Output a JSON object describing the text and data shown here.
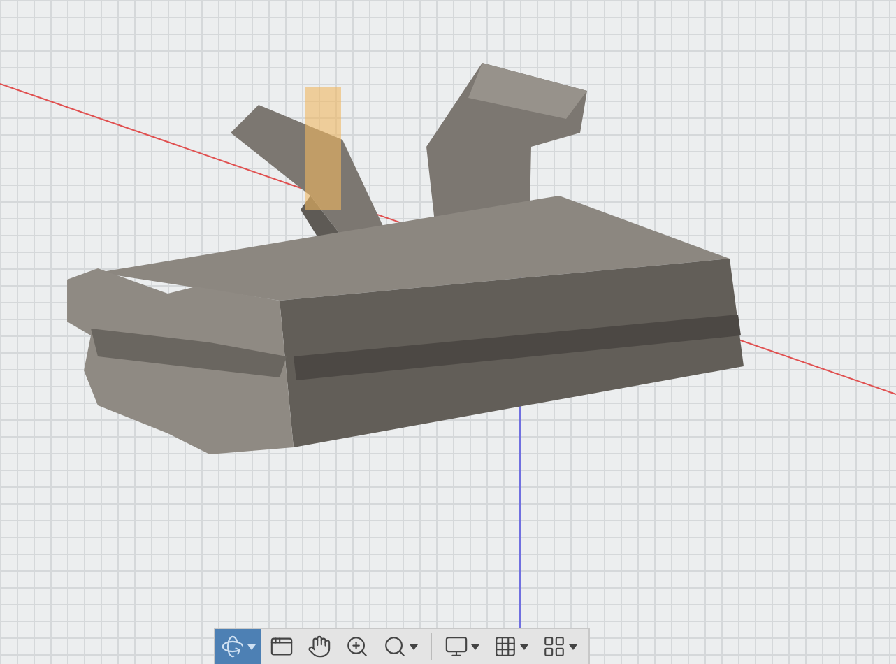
{
  "toolbar": {
    "tools": [
      {
        "kind": "orbit",
        "selected": true,
        "dropdown": true
      },
      {
        "kind": "look_at",
        "selected": false,
        "dropdown": false
      },
      {
        "kind": "pan",
        "selected": false,
        "dropdown": false
      },
      {
        "kind": "zoom",
        "selected": false,
        "dropdown": false
      },
      {
        "kind": "fit",
        "selected": false,
        "dropdown": true
      },
      {
        "kind": "display",
        "selected": false,
        "dropdown": true
      },
      {
        "kind": "grid",
        "selected": false,
        "dropdown": true
      },
      {
        "kind": "viewports",
        "selected": false,
        "dropdown": true
      }
    ]
  }
}
